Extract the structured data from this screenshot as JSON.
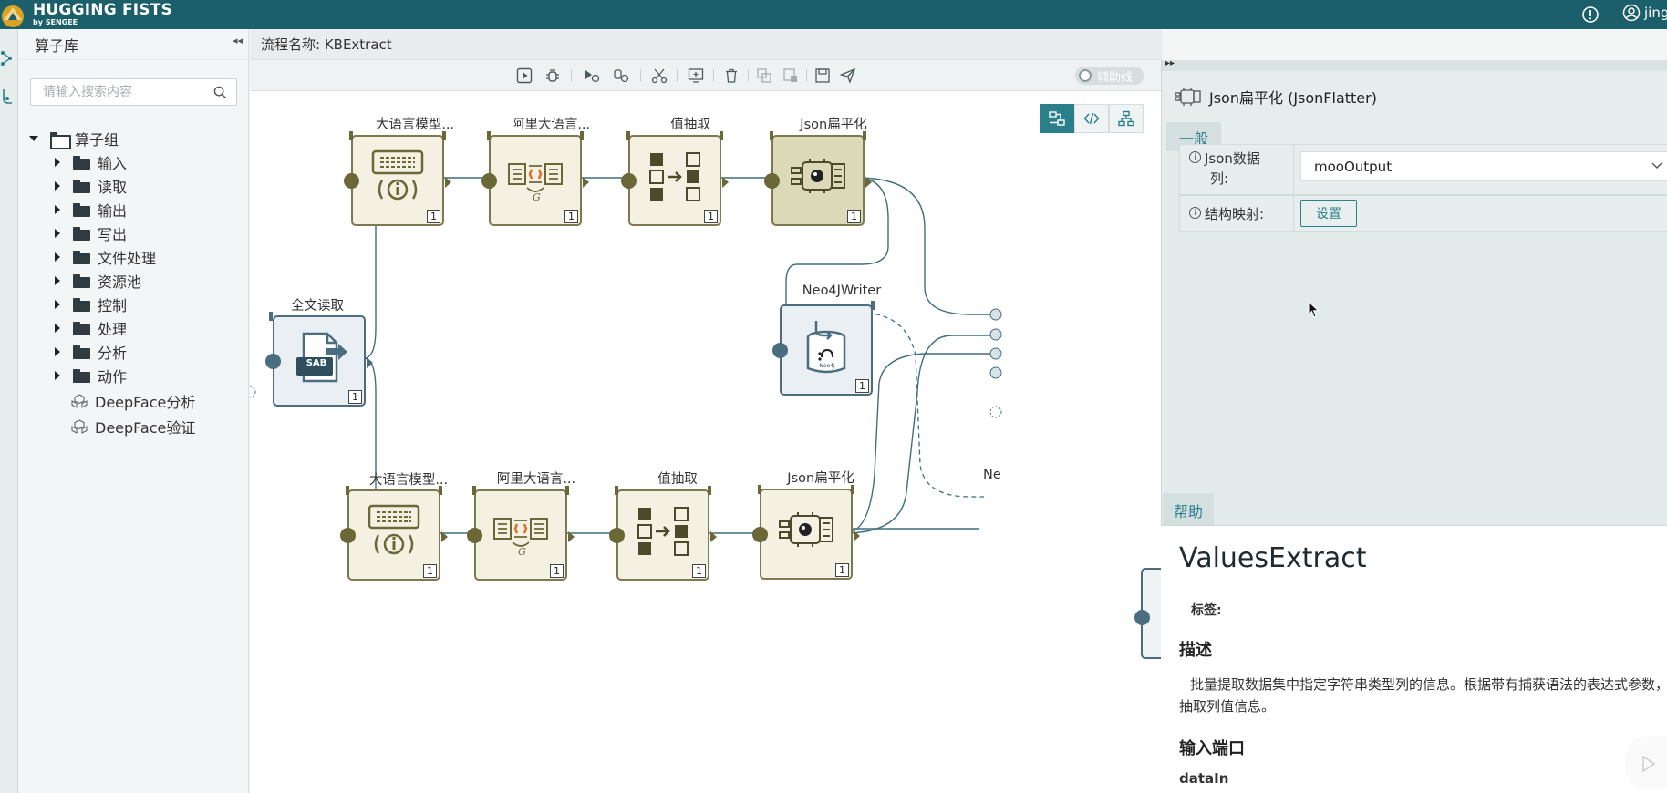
{
  "header": {
    "brand": "HUGGING FISTS",
    "brand_sub": "by SENGEE",
    "user": "jing"
  },
  "library": {
    "title": "算子库",
    "search_placeholder": "请输入搜索内容",
    "root": "算子组",
    "folders": [
      "输入",
      "读取",
      "输出",
      "写出",
      "文件处理",
      "资源池",
      "控制",
      "处理",
      "分析",
      "动作"
    ],
    "leaves": [
      "DeepFace分析",
      "DeepFace验证"
    ]
  },
  "flow": {
    "title": "流程名称: KBExtract"
  },
  "toolbar": {
    "aux_line": "辅助线"
  },
  "canvas": {
    "nodes": [
      {
        "label": "全文读取",
        "count": "1",
        "icon": "file-read-icon"
      },
      {
        "label": "大语言模型...",
        "count": "1",
        "icon": "llm-icon"
      },
      {
        "label": "阿里大语言...",
        "count": "1",
        "icon": "ali-llm-icon"
      },
      {
        "label": "值抽取",
        "count": "1",
        "icon": "values-extract-icon"
      },
      {
        "label": "Json扁平化",
        "count": "1",
        "icon": "json-flatten-icon"
      },
      {
        "label": "Neo4JWriter",
        "count": "1",
        "icon": "neo4j-icon",
        "icon_text": "Neo4j"
      },
      {
        "label": "大语言模型...",
        "count": "1",
        "icon": "llm-icon"
      },
      {
        "label": "阿里大语言...",
        "count": "1",
        "icon": "ali-llm-icon"
      },
      {
        "label": "值抽取",
        "count": "1",
        "icon": "values-extract-icon"
      },
      {
        "label": "Json扁平化",
        "count": "1",
        "icon": "json-flatten-icon"
      },
      {
        "label": "Ne",
        "count": "",
        "icon": "neo4j-icon"
      }
    ],
    "sab_text": "SAB"
  },
  "props": {
    "title": "Json扁平化 (JsonFlatter)",
    "tab_general": "一般",
    "field_json_label_1": "Json数据",
    "field_json_label_2": "列:",
    "field_json_value": "mooOutput",
    "field_map_label": "结构映射:",
    "btn_setting": "设置"
  },
  "help": {
    "tab": "帮助",
    "title": "ValuesExtract",
    "tags_label": "标签:",
    "desc_heading": "描述",
    "desc_text": "批量提取数据集中指定字符串类型列的信息。根据带有捕获语法的表达式参数，抽取列值信息。",
    "input_heading": "输入端口",
    "input_port": "dataIn"
  },
  "colors": {
    "header_bg": "#1b5f6a",
    "accent": "#2a7f8a",
    "node_border": "#7d7a52",
    "node_fill": "#f4f1e3",
    "edge": "#3f6f7d"
  }
}
